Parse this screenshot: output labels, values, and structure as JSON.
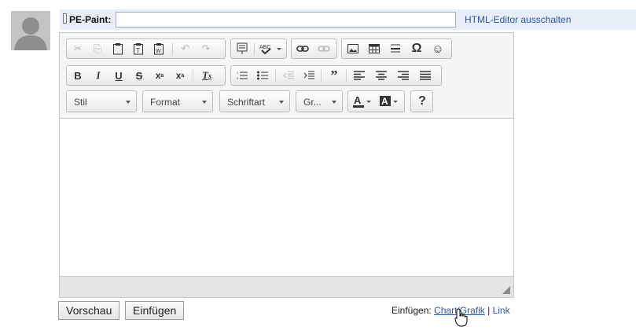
{
  "post": {
    "label": "PE-Paint:",
    "title_value": "",
    "html_toggle": "HTML-Editor ausschalten"
  },
  "toolbar": {
    "row1": [
      {
        "name": "cut-icon",
        "glyph": "✂",
        "enabled": false
      },
      {
        "name": "copy-icon",
        "glyph": "⎘",
        "enabled": false
      },
      {
        "name": "paste-icon",
        "glyph": "📋",
        "enabled": true
      },
      {
        "name": "paste-text-icon",
        "glyph": "T",
        "enabled": true
      },
      {
        "name": "paste-word-icon",
        "glyph": "W",
        "enabled": true
      },
      {
        "name": "undo-icon",
        "glyph": "↶",
        "enabled": false
      },
      {
        "name": "redo-icon",
        "glyph": "↷",
        "enabled": false
      },
      {
        "name": "templates-icon",
        "glyph": "▤",
        "enabled": true
      },
      {
        "name": "spellcheck-icon",
        "glyph": "ABC",
        "enabled": true
      },
      {
        "name": "link-icon",
        "glyph": "∞",
        "enabled": true
      },
      {
        "name": "unlink-icon",
        "glyph": "∞",
        "enabled": false
      },
      {
        "name": "image-icon",
        "glyph": "▣",
        "enabled": true
      },
      {
        "name": "table-icon",
        "glyph": "▦",
        "enabled": true
      },
      {
        "name": "horizontal-line-icon",
        "glyph": "≡",
        "enabled": true
      },
      {
        "name": "special-char-icon",
        "glyph": "Ω",
        "enabled": true
      },
      {
        "name": "smiley-icon",
        "glyph": "☺",
        "enabled": true
      }
    ],
    "row2": [
      {
        "name": "bold-icon",
        "glyph": "B"
      },
      {
        "name": "italic-icon",
        "glyph": "I"
      },
      {
        "name": "underline-icon",
        "glyph": "U"
      },
      {
        "name": "strike-icon",
        "glyph": "S"
      },
      {
        "name": "subscript-icon",
        "glyph": "x₂"
      },
      {
        "name": "superscript-icon",
        "glyph": "x²"
      },
      {
        "name": "remove-format-icon",
        "glyph": "Tx"
      },
      {
        "name": "numbered-list-icon",
        "glyph": "≔"
      },
      {
        "name": "bullet-list-icon",
        "glyph": "☰"
      },
      {
        "name": "outdent-icon",
        "glyph": "⇤"
      },
      {
        "name": "indent-icon",
        "glyph": "⇥"
      },
      {
        "name": "blockquote-icon",
        "glyph": "❞"
      },
      {
        "name": "align-left-icon",
        "glyph": "≡"
      },
      {
        "name": "align-center-icon",
        "glyph": "≡"
      },
      {
        "name": "align-right-icon",
        "glyph": "≡"
      },
      {
        "name": "justify-icon",
        "glyph": "≡"
      }
    ],
    "combos": {
      "style": "Stil",
      "format": "Format",
      "font": "Schriftart",
      "size": "Gr...",
      "help": "?"
    }
  },
  "actions": {
    "preview": "Vorschau",
    "insert": "Einfügen"
  },
  "insert_links": {
    "prefix": "Einfügen:",
    "chart": "Chart/Grafik",
    "separator": "|",
    "link": "Link"
  }
}
